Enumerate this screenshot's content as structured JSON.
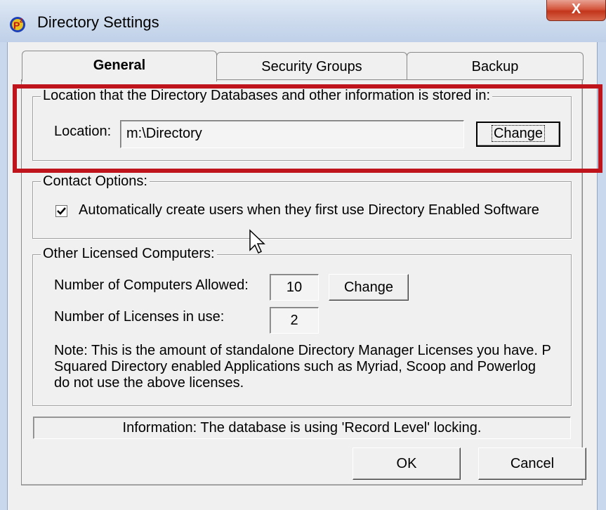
{
  "window": {
    "title": "Directory Settings",
    "close_label": "X"
  },
  "tabs": [
    {
      "label": "General",
      "active": true
    },
    {
      "label": "Security Groups",
      "active": false
    },
    {
      "label": "Backup",
      "active": false
    }
  ],
  "location_group": {
    "title": "Location that the Directory Databases and other information is stored in:",
    "label": "Location:",
    "value": "m:\\Directory",
    "change_label": "Change"
  },
  "contact_group": {
    "title": "Contact Options:",
    "auto_create_label": "Automatically create users when they first use Directory Enabled Software",
    "auto_create_checked": true
  },
  "licensed_group": {
    "title": "Other Licensed Computers:",
    "allowed_label": "Number of Computers Allowed:",
    "allowed_value": "10",
    "change_label": "Change",
    "in_use_label": "Number of Licenses in use:",
    "in_use_value": "2",
    "note": "Note: This is the amount of standalone Directory Manager Licenses you have. P Squared Directory enabled Applications such as Myriad, Scoop and Powerlog do not use the above licenses."
  },
  "status_text": "Information: The database is using 'Record Level' locking.",
  "buttons": {
    "ok": "OK",
    "cancel": "Cancel"
  },
  "colors": {
    "highlight": "#c0141c",
    "window_bg": "#f0f0f0"
  }
}
